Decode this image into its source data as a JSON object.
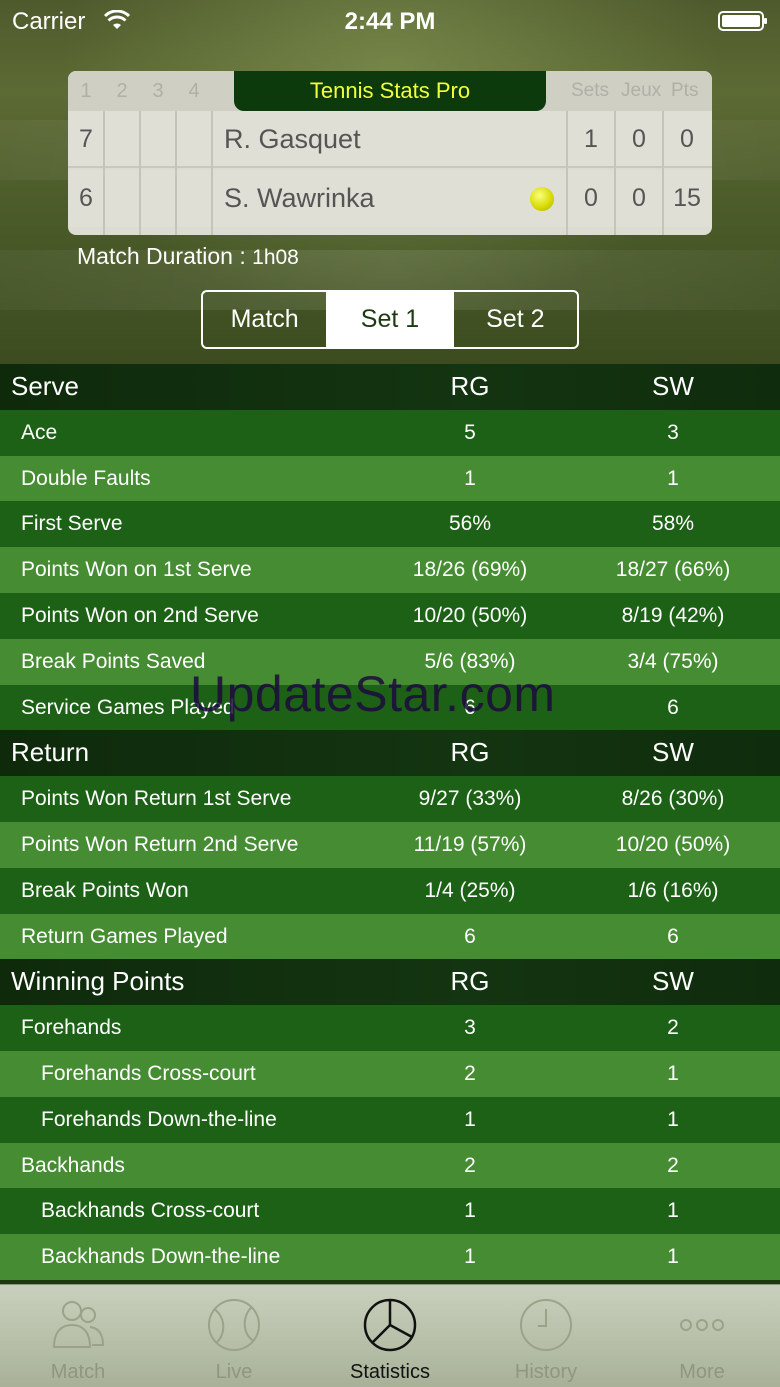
{
  "status_bar": {
    "carrier": "Carrier",
    "time": "2:44 PM"
  },
  "scoreboard": {
    "set_numbers": [
      "1",
      "2",
      "3",
      "4"
    ],
    "title": "Tennis Stats Pro",
    "col_sets": "Sets",
    "col_games": "Jeux",
    "col_points": "Pts",
    "players": [
      {
        "rank": "7",
        "name": "R. Gasquet",
        "sets": "1",
        "games": "0",
        "points": "0",
        "serving": false
      },
      {
        "rank": "6",
        "name": "S. Wawrinka",
        "sets": "0",
        "games": "0",
        "points": "15",
        "serving": true
      }
    ]
  },
  "match_duration": {
    "label": "Match Duration :",
    "value": "1h08"
  },
  "segments": {
    "items": [
      "Match",
      "Set 1",
      "Set 2"
    ],
    "selected": "Set 1"
  },
  "sections": [
    {
      "title": "Serve",
      "col1": "RG",
      "col2": "SW",
      "rows": [
        {
          "label": "Ace",
          "v1": "5",
          "v2": "3"
        },
        {
          "label": "Double Faults",
          "v1": "1",
          "v2": "1"
        },
        {
          "label": "First Serve",
          "v1": "56%",
          "v2": "58%"
        },
        {
          "label": "Points Won on 1st Serve",
          "v1": "18/26 (69%)",
          "v2": "18/27 (66%)"
        },
        {
          "label": "Points Won on 2nd Serve",
          "v1": "10/20 (50%)",
          "v2": "8/19 (42%)"
        },
        {
          "label": "Break Points Saved",
          "v1": "5/6 (83%)",
          "v2": "3/4 (75%)"
        },
        {
          "label": "Service Games Played",
          "v1": "6",
          "v2": "6"
        }
      ]
    },
    {
      "title": "Return",
      "col1": "RG",
      "col2": "SW",
      "rows": [
        {
          "label": "Points Won Return 1st Serve",
          "v1": "9/27 (33%)",
          "v2": "8/26 (30%)"
        },
        {
          "label": "Points Won Return 2nd Serve",
          "v1": "11/19 (57%)",
          "v2": "10/20 (50%)"
        },
        {
          "label": "Break Points Won",
          "v1": "1/4 (25%)",
          "v2": "1/6 (16%)"
        },
        {
          "label": "Return Games Played",
          "v1": "6",
          "v2": "6"
        }
      ]
    },
    {
      "title": "Winning Points",
      "col1": "RG",
      "col2": "SW",
      "rows": [
        {
          "label": "Forehands",
          "v1": "3",
          "v2": "2"
        },
        {
          "label": "Forehands Cross-court",
          "v1": "2",
          "v2": "1",
          "sub": true
        },
        {
          "label": "Forehands Down-the-line",
          "v1": "1",
          "v2": "1",
          "sub": true
        },
        {
          "label": "Backhands",
          "v1": "2",
          "v2": "2"
        },
        {
          "label": "Backhands Cross-court",
          "v1": "1",
          "v2": "1",
          "sub": true
        },
        {
          "label": "Backhands Down-the-line",
          "v1": "1",
          "v2": "1",
          "sub": true
        }
      ]
    }
  ],
  "watermark": "UpdateStar.com",
  "tabbar": {
    "items": [
      {
        "label": "Match",
        "icon": "users-icon"
      },
      {
        "label": "Live",
        "icon": "tennis-ball-icon"
      },
      {
        "label": "Statistics",
        "icon": "pie-chart-icon"
      },
      {
        "label": "History",
        "icon": "clock-icon"
      },
      {
        "label": "More",
        "icon": "more-dots-icon"
      }
    ],
    "selected": "Statistics"
  }
}
